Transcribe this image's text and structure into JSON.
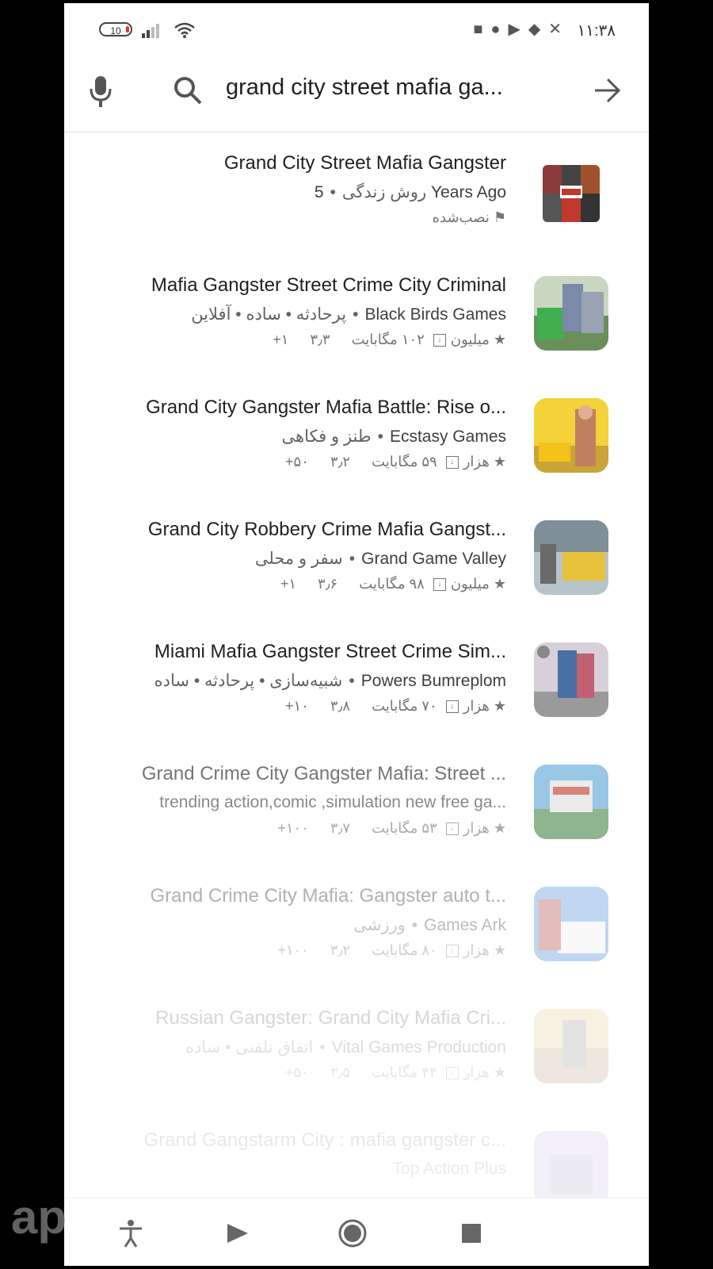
{
  "status_bar": {
    "battery": "10",
    "time": "١١:٣٨"
  },
  "search": {
    "query": "grand city street mafia ga..."
  },
  "results": [
    {
      "title": "Grand City Street Mafia Gangster",
      "developer": "5 Years Ago",
      "category": "روش زندگی",
      "installed": "نصب‌شده"
    },
    {
      "title": "Mafia Gangster Street Crime City Criminal",
      "developer": "Black Birds Games",
      "category": "پرحادثه • ساده • آفلاین",
      "rating": "۳٫۳",
      "size": "۱۰۲ مگابایت",
      "downloads": "+۱ میلیون"
    },
    {
      "title": "Grand City Gangster Mafia Battle: Rise o...",
      "developer": "Ecstasy Games",
      "category": "طنز و فکاهی",
      "rating": "۳٫۲",
      "size": "۵۹ مگابایت",
      "downloads": "+۵۰ هزار"
    },
    {
      "title": "Grand City Robbery Crime Mafia Gangst...",
      "developer": "Grand Game Valley",
      "category": "سفر و محلی",
      "rating": "۳٫۶",
      "size": "۹۸ مگابایت",
      "downloads": "+۱ میلیون"
    },
    {
      "title": "Miami Mafia Gangster Street Crime Sim...",
      "developer": "Powers Bumreplom",
      "category": "شبیه‌سازی • پرحادثه • ساده",
      "rating": "۳٫۸",
      "size": "۷۰ مگابایت",
      "downloads": "+۱۰ هزار"
    },
    {
      "title": "Grand Crime City Gangster Mafia: Street ...",
      "developer": "trending action,comic ,simulation new free ga...",
      "category": "",
      "rating": "۳٫۷",
      "size": "۵۳ مگابایت",
      "downloads": "+۱۰۰ هزار"
    },
    {
      "title": "Grand Crime City Mafia: Gangster auto t...",
      "developer": "Games Ark",
      "category": "ورزشی",
      "rating": "۳٫۲",
      "size": "۸۰ مگابایت",
      "downloads": "+۱۰۰ هزار"
    },
    {
      "title": "Russian Gangster: Grand City Mafia Cri...",
      "developer": "Vital Games Production",
      "category": "اتفاق تلفنی • ساده",
      "rating": "۳٫۵",
      "size": "۴۴ مگابایت",
      "downloads": "+۵۰ هزار"
    },
    {
      "title": "Grand Gangstarm City : mafia gangster c...",
      "developer": "Top Action Plus",
      "category": "",
      "rating": "",
      "size": "",
      "downloads": ""
    }
  ],
  "watermark": "ap",
  "colors": {
    "text": "#202124",
    "secondary": "#5f6368",
    "background": "#ffffff",
    "frame": "#000000"
  },
  "icons": {
    "mic": "microphone-icon",
    "search": "search-icon",
    "submit": "arrow-right-icon"
  }
}
